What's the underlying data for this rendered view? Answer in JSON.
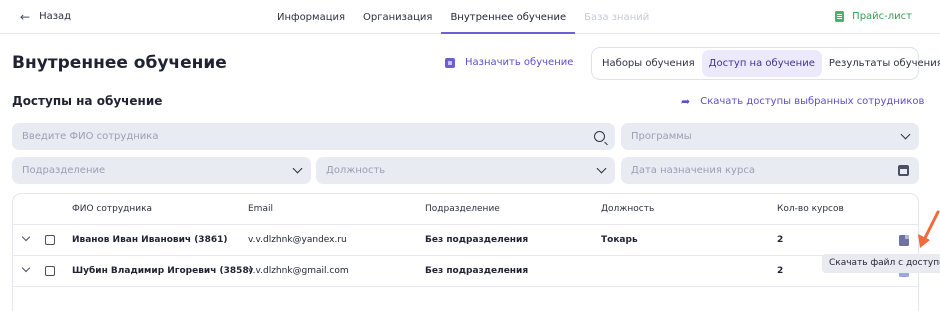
{
  "nav": {
    "back_label": "Назад",
    "tabs": [
      {
        "label": "Информация",
        "state": "normal"
      },
      {
        "label": "Организация",
        "state": "normal"
      },
      {
        "label": "Внутреннее обучение",
        "state": "active"
      },
      {
        "label": "База знаний",
        "state": "disabled"
      }
    ],
    "price_label": "Прайс-лист"
  },
  "header": {
    "title": "Внутреннее обучение",
    "assign_label": "Назначить обучение",
    "segments": [
      {
        "label": "Наборы обучения",
        "active": false
      },
      {
        "label": "Доступ на обучение",
        "active": true
      },
      {
        "label": "Результаты обучения",
        "active": false
      }
    ]
  },
  "section": {
    "title": "Доступы на обучение",
    "download_all_label": "Скачать доступы выбранных сотрудников"
  },
  "filters": {
    "search_placeholder": "Введите ФИО сотрудника",
    "programs_placeholder": "Программы",
    "department_placeholder": "Подразделение",
    "position_placeholder": "Должность",
    "date_placeholder": "Дата назначения курса"
  },
  "table": {
    "columns": [
      "ФИО сотрудника",
      "Email",
      "Подразделение",
      "Должность",
      "Кол-во курсов"
    ],
    "rows": [
      {
        "name": "Иванов Иван Иванович (3861)",
        "email": "v.v.dlzhnk@yandex.ru",
        "department": "Без подразделения",
        "position": "Токарь",
        "courses": "2"
      },
      {
        "name": "Шубин Владимир Игоревич (3858)",
        "email": "v.v.dlzhnk@gmail.com",
        "department": "Без подразделения",
        "position": "",
        "courses": "2"
      }
    ]
  },
  "tooltip": {
    "text": "Скачать файл с доступом"
  },
  "colors": {
    "accent": "#6b5fd3",
    "price_green": "#2f9e55",
    "arrow": "#f06a3c",
    "field_bg": "#e8ebf2"
  }
}
